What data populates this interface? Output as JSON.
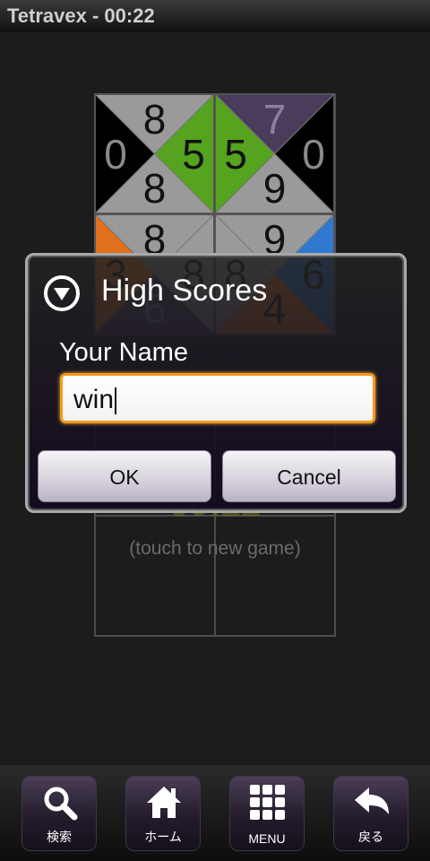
{
  "window": {
    "title": "Tetravex - 00:22"
  },
  "board": {
    "tiles": [
      {
        "top": "8",
        "left": "0",
        "right": "5",
        "bottom": "8",
        "colors": {
          "top": "#9a9a9a",
          "left": "#000000",
          "right": "#55a31e",
          "bottom": "#9a9a9a"
        }
      },
      {
        "top": "7",
        "left": "5",
        "right": "0",
        "bottom": "9",
        "colors": {
          "top": "#4a3d5c",
          "left": "#55a31e",
          "right": "#000000",
          "bottom": "#9a9a9a"
        }
      },
      {
        "top": "8",
        "left": "3",
        "right": "8",
        "bottom": "6",
        "colors": {
          "top": "#9a9a9a",
          "left": "#e0701c",
          "right": "#9a9a9a",
          "bottom": "#4a3d5c"
        }
      },
      {
        "top": "9",
        "left": "8",
        "right": "6",
        "bottom": "4",
        "colors": {
          "top": "#9a9a9a",
          "left": "#9a9a9a",
          "right": "#2f7ad0",
          "bottom": "#e0701c"
        }
      }
    ],
    "time_text": "00:22",
    "new_game_text": "(touch to new game)"
  },
  "dialog": {
    "title": "High Scores",
    "name_label": "Your Name",
    "name_value": "win",
    "ok_label": "OK",
    "cancel_label": "Cancel"
  },
  "navbar": {
    "search_label": "検索",
    "home_label": "ホーム",
    "menu_label": "MENU",
    "back_label": "戻る"
  }
}
